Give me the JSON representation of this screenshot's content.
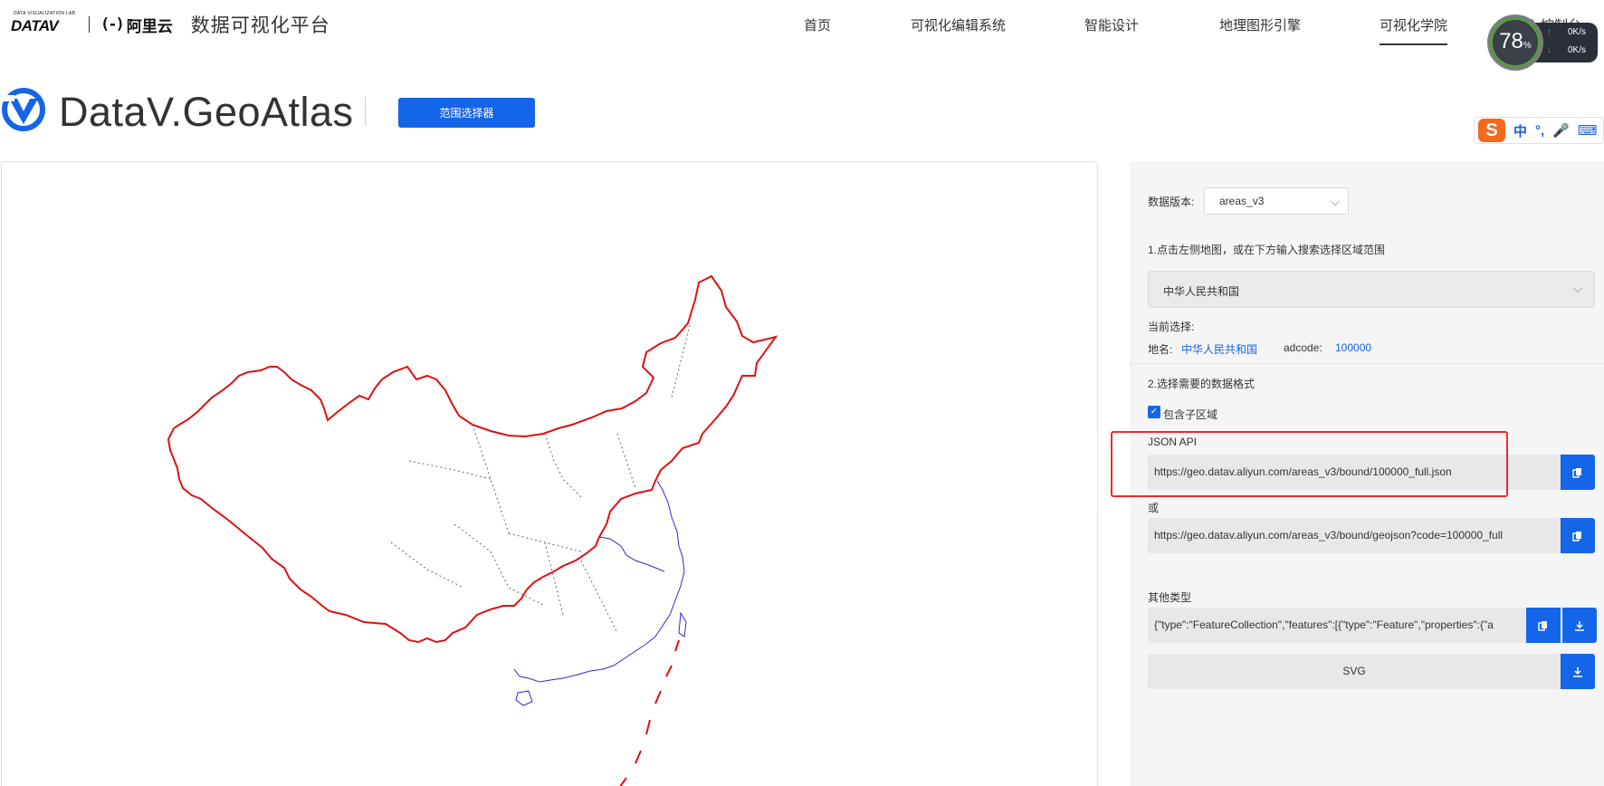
{
  "topbar": {
    "lab_text": "DATA VISUALIZATION LAB",
    "datav_word": "DATAV",
    "aliyun_bracket": "(-)",
    "aliyun_word": "阿里云",
    "platform_title": "数据可视化平台",
    "nav": [
      "首页",
      "可视化编辑系统",
      "智能设计",
      "地理图形引擎",
      "可视化学院"
    ],
    "active_nav": "可视化学院",
    "partial_right": "进入控制台"
  },
  "net_widget": {
    "percent": "78",
    "percent_unit": "%",
    "up_speed": "0K/s",
    "down_speed": "0K/s",
    "ring_color": "#5b9b40"
  },
  "ime": {
    "items": [
      "中",
      "°,",
      "🎤",
      "⌨"
    ]
  },
  "geo": {
    "title": "DataV.GeoAtlas",
    "range_button": "范围选择器",
    "accent": "#1565e8"
  },
  "map": {
    "boundary_color": "#e01010",
    "coast_color": "#2a2ad0"
  },
  "panel": {
    "version_label": "数据版本:",
    "version_value": "areas_v3",
    "step1": "1.点击左侧地图，或在下方输入搜索选择区域范围",
    "region_value": "中华人民共和国",
    "current_label": "当前选择:",
    "name_label": "地名:",
    "name_value": "中华人民共和国",
    "adcode_label": "adcode:",
    "adcode_value": "100000",
    "step2": "2.选择需要的数据格式",
    "include_sub": "包含子区域",
    "json_api_label": "JSON API",
    "json_api_url": "https://geo.datav.aliyun.com/areas_v3/bound/100000_full.json",
    "or_label": "或",
    "geojson_url": "https://geo.datav.aliyun.com/areas_v3/bound/geojson?code=100000_full",
    "other_label": "其他类型",
    "other_value": "{\"type\":\"FeatureCollection\",\"features\":[{\"type\":\"Feature\",\"properties\":{\"a",
    "svg_label": "SVG"
  }
}
